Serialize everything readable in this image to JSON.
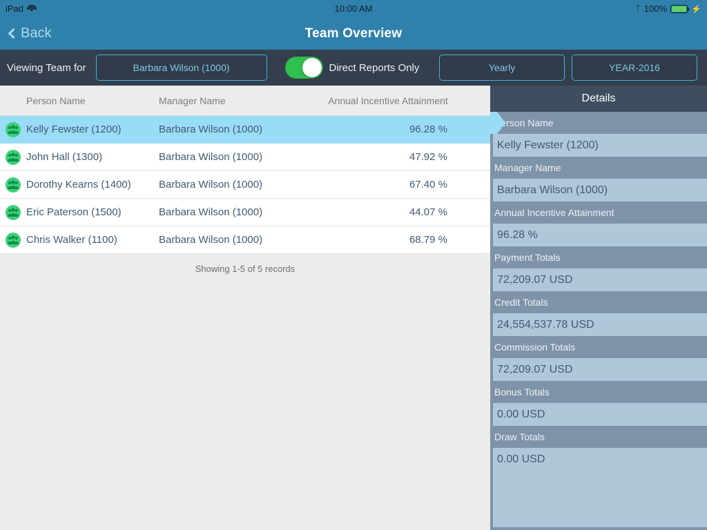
{
  "status_bar": {
    "device": "iPad",
    "wifi_icon": "wifi-icon",
    "time": "10:00 AM",
    "bluetooth_icon": "bluetooth-icon",
    "battery_percent": "100%",
    "battery_icon": "battery-icon",
    "charging_icon": "lightning-bolt-icon"
  },
  "nav_bar": {
    "back_label": "Back",
    "back_icon": "chevron-left-icon",
    "title": "Team Overview"
  },
  "toolbar": {
    "viewing_label": "Viewing Team for",
    "person_filter": "Barbara Wilson (1000)",
    "direct_reports_label": "Direct Reports Only",
    "direct_reports_on": true,
    "period_type": "Yearly",
    "period_value": "YEAR-2016"
  },
  "table": {
    "columns": [
      "Person Name",
      "Manager Name",
      "Annual Incentive Attainment"
    ],
    "rows": [
      {
        "icon": "group-icon",
        "person": "Kelly Fewster (1200)",
        "manager": "Barbara Wilson (1000)",
        "attainment": "96.28 %",
        "selected": true
      },
      {
        "icon": "group-icon",
        "person": "John Hall (1300)",
        "manager": "Barbara Wilson (1000)",
        "attainment": "47.92 %",
        "selected": false
      },
      {
        "icon": "group-icon",
        "person": "Dorothy Kearns (1400)",
        "manager": "Barbara Wilson (1000)",
        "attainment": "67.40 %",
        "selected": false
      },
      {
        "icon": "group-icon",
        "person": "Eric Paterson (1500)",
        "manager": "Barbara Wilson (1000)",
        "attainment": "44.07 %",
        "selected": false
      },
      {
        "icon": "group-icon",
        "person": "Chris Walker (1100)",
        "manager": "Barbara Wilson (1000)",
        "attainment": "68.79 %",
        "selected": false
      }
    ],
    "footer": "Showing 1-5 of 5 records"
  },
  "details": {
    "title": "Details",
    "fields": [
      {
        "label": "Person Name",
        "value": "Kelly Fewster (1200)"
      },
      {
        "label": "Manager Name",
        "value": "Barbara Wilson (1000)"
      },
      {
        "label": "Annual Incentive Attainment",
        "value": "96.28 %"
      },
      {
        "label": "Payment Totals",
        "value": "72,209.07 USD"
      },
      {
        "label": "Credit Totals",
        "value": "24,554,537.78 USD"
      },
      {
        "label": "Commission Totals",
        "value": "72,209.07 USD"
      },
      {
        "label": "Bonus Totals",
        "value": "0.00 USD"
      },
      {
        "label": "Draw Totals",
        "value": "0.00 USD"
      }
    ]
  },
  "colors": {
    "nav_blue": "#2f80ab",
    "toolbar_dark": "#343e4c",
    "accent_cyan": "#3fb6e0",
    "selection_blue": "#99dcf5",
    "toggle_green": "#2fc04f",
    "detail_label_bg": "#7e93a8",
    "detail_value_bg": "#afc8d9",
    "row_text": "#3f5a72"
  }
}
